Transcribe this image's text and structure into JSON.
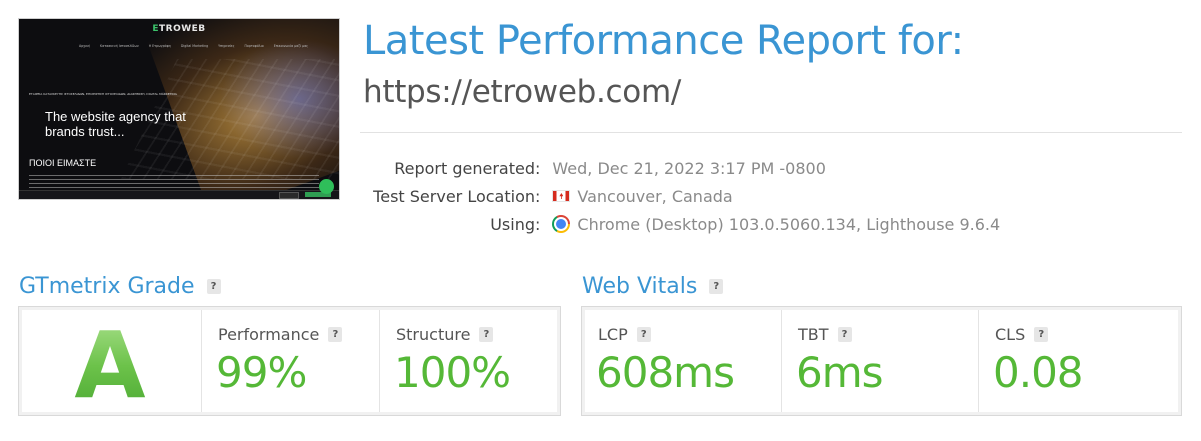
{
  "thumbnail": {
    "logo_prefix": "E",
    "logo_rest": "TROWEB",
    "nav": [
      "Αρχική",
      "Κατασκευή Ιστοσελίδων",
      "Η Ετρωγράφη",
      "Digital Marketing",
      "Υπηρεσίες",
      "Πορτοφόλιο",
      "Επικοινωνία μαζί μας"
    ],
    "small_text": "ΕΤΑΙΡΕΙΑ ΚΑΤΑΣΚΕΥΗΣ ΙΣΤΟΣΕΛΙΔΩΝ, ΕΠΙΧΕΙΡΗΣΗ ΙΣΤΟΣΕΛΙΔΩΝ, ΔΙΑΦΗΜΙΣΗ, DIGITAL MARKETING",
    "hero_line1": "The website agency that",
    "hero_line2": "brands trust...",
    "about": "ΠΟΙΟΙ ΕΙΜΑΣΤΕ"
  },
  "header": {
    "title": "Latest Performance Report for:",
    "url": "https://etroweb.com/"
  },
  "meta": {
    "report_generated_label": "Report generated",
    "report_generated_value": "Wed, Dec 21, 2022 3:17 PM -0800",
    "server_label": "Test Server Location",
    "server_value": "Vancouver, Canada",
    "using_label": "Using",
    "using_value": "Chrome (Desktop) 103.0.5060.134, Lighthouse 9.6.4",
    "colon": ":"
  },
  "gtmetrix": {
    "heading": "GTmetrix Grade",
    "help": "?",
    "grade": "A",
    "performance_label": "Performance",
    "performance_value": "99%",
    "structure_label": "Structure",
    "structure_value": "100%"
  },
  "web_vitals": {
    "heading": "Web Vitals",
    "help": "?",
    "lcp_label": "LCP",
    "lcp_value": "608ms",
    "tbt_label": "TBT",
    "tbt_value": "6ms",
    "cls_label": "CLS",
    "cls_value": "0.08"
  },
  "colors": {
    "accent_blue": "#3a95d3",
    "grade_green": "#55b837"
  }
}
